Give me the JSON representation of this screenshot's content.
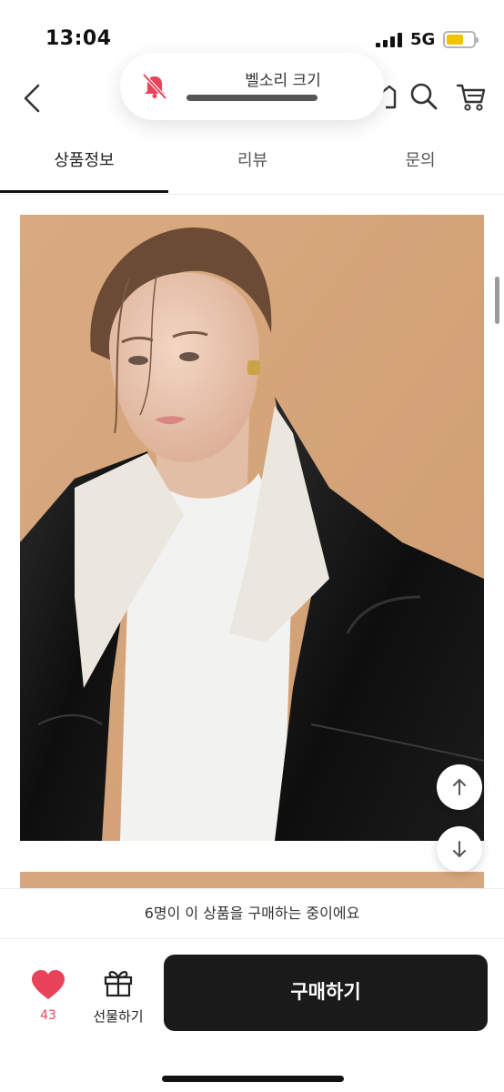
{
  "status_bar": {
    "time": "13:04",
    "network": "5G",
    "battery_color": "#f2c400"
  },
  "volume_hud": {
    "label": "벨소리 크기",
    "icon": "bell-slash-icon",
    "icon_color": "#e8435a"
  },
  "nav": {
    "back_icon": "chevron-left-icon",
    "home_icon": "home-icon",
    "search_icon": "search-icon",
    "cart_icon": "cart-icon"
  },
  "tabs": [
    {
      "label": "상품정보",
      "active": true
    },
    {
      "label": "리뷰",
      "active": false
    },
    {
      "label": "문의",
      "active": false
    }
  ],
  "product_image": {
    "background_color": "#d6a67c",
    "scroll_up_icon": "arrow-up-icon",
    "scroll_down_icon": "arrow-down-icon"
  },
  "purchase_note": "6명이 이 상품을 구매하는 중이에요",
  "bottom_bar": {
    "like_icon": "heart-icon",
    "like_count": "43",
    "like_color": "#e8435a",
    "gift_icon": "gift-icon",
    "gift_label": "선물하기",
    "buy_label": "구매하기"
  }
}
